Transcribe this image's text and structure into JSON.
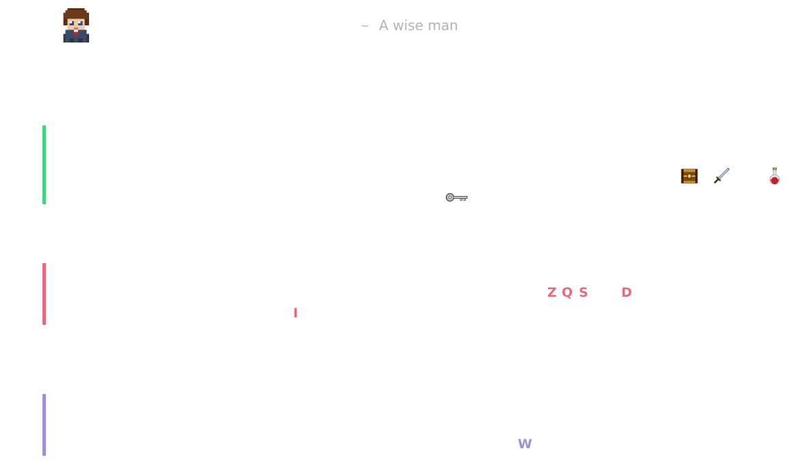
{
  "quote": {
    "tilde": "~",
    "author": "A wise man"
  },
  "avatar": {
    "icon": "pixel-hero-avatar-icon"
  },
  "colors": {
    "green_bar": "#3fd37a",
    "red_bar": "#e8697e",
    "purple_bar": "#9c8ee0",
    "quote_text": "#b3b3b3"
  },
  "items": {
    "key": "key-icon",
    "chest": "treasure-chest-icon",
    "sword": "sword-icon",
    "potion": "red-potion-icon"
  },
  "controls": {
    "move_up": "Z",
    "move_left": "Q",
    "move_down": "S",
    "move_right": "D",
    "inventory": "I",
    "weapon": "W"
  }
}
